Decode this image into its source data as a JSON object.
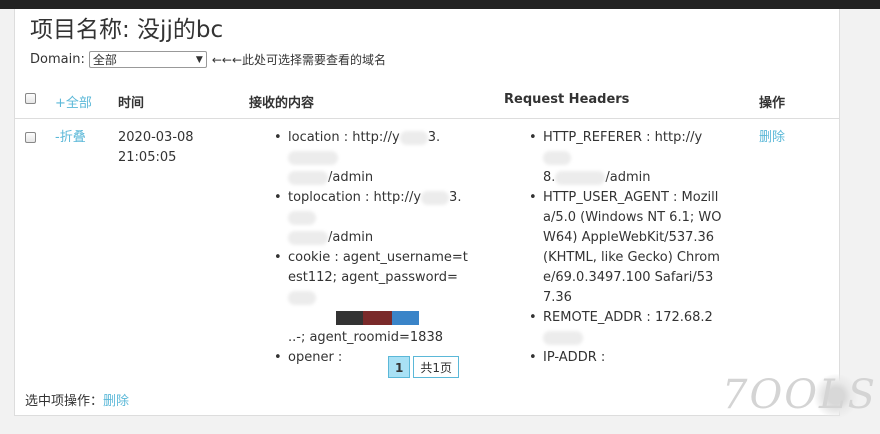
{
  "project": {
    "title": "项目名称: 没jj的bc"
  },
  "domain": {
    "label": "Domain:",
    "selected": "全部",
    "hint": "←←←此处可选择需要查看的域名"
  },
  "table": {
    "headers": {
      "expand_all": "+全部",
      "time": "时间",
      "content": "接收的内容",
      "request_headers": "Request Headers",
      "action": "操作"
    },
    "rows": [
      {
        "collapse": "-折叠",
        "date": "2020-03-08",
        "time": "21:05:05",
        "content": [
          {
            "text_a": "location : http://y",
            "text_b": "3.",
            "text_c": "/admin"
          },
          {
            "text_a": "toplocation : http://y",
            "text_b": "3.",
            "text_c": "/admin"
          },
          {
            "text_a": "cookie : agent_username=test112; agent_password=",
            "text_c": "..-; agent_roomid=1838"
          },
          {
            "text_a": "opener :"
          }
        ],
        "headers": [
          {
            "text_a": "HTTP_REFERER : http://y",
            "text_b": "8.",
            "text_c": "/admin"
          },
          {
            "text": "HTTP_USER_AGENT : Mozilla/5.0 (Windows NT 6.1; WOW64) AppleWebKit/537.36 (KHTML, like Gecko) Chrome/69.0.3497.100 Safari/537.36"
          },
          {
            "text": "REMOTE_ADDR : 172.68.2"
          },
          {
            "text": "IP-ADDR :"
          }
        ],
        "delete": "删除"
      }
    ]
  },
  "pagination": {
    "current": "1",
    "total": "共1页"
  },
  "bulk": {
    "label": "选中项操作：",
    "delete": "删除"
  },
  "watermark": "7OOLS",
  "colors": {
    "link": "#5bb8d8",
    "active_page": "#a9e1f5",
    "topbar": "#222222"
  }
}
